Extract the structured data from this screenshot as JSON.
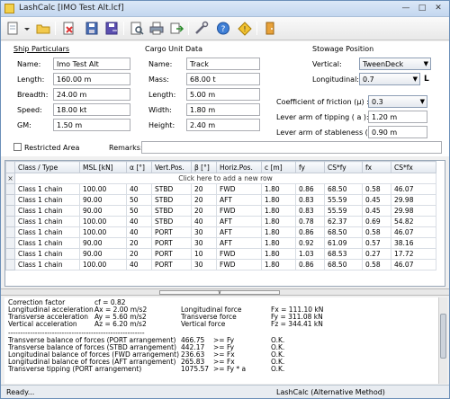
{
  "window": {
    "title": "LashCalc [IMO Test Alt.lcf]"
  },
  "toolbar": {
    "buttons": [
      "new-icon",
      "open-icon",
      "clear-icon",
      "save-icon",
      "save-as-icon",
      "preview-icon",
      "print-icon",
      "export-icon",
      "settings-icon",
      "help-icon",
      "info-icon",
      "exit-icon"
    ]
  },
  "ship": {
    "heading": "Ship Particulars",
    "name_label": "Name:",
    "name": "Imo Test Alt",
    "length_label": "Length:",
    "length": "160.00 m",
    "breadth_label": "Breadth:",
    "breadth": "24.00 m",
    "speed_label": "Speed:",
    "speed": "18.00 kt",
    "gm_label": "GM:",
    "gm": "1.50 m"
  },
  "cargo": {
    "heading": "Cargo Unit Data",
    "name_label": "Name:",
    "name": "Track",
    "mass_label": "Mass:",
    "mass": "68.00 t",
    "length_label": "Length:",
    "length": "5.00 m",
    "width_label": "Width:",
    "width": "1.80 m",
    "height_label": "Height:",
    "height": "2.40 m"
  },
  "stowage": {
    "heading": "Stowage Position",
    "vertical_label": "Vertical:",
    "vertical": "TweenDeck",
    "longitudinal_label": "Longitudinal:",
    "longitudinal": "0.7",
    "longitudinal_unit": "L",
    "friction_label": "Coefficient of friction (μ) :",
    "friction": "0.3",
    "tipping_label": "Lever arm of tipping ( a ):",
    "tipping": "1.20 m",
    "stableness_label": "Lever arm of stableness ( b ):",
    "stableness": "0.90 m"
  },
  "restricted_label": "Restricted Area",
  "remarks_label": "Remarks:",
  "remarks": "",
  "grid": {
    "columns": [
      "Class / Type",
      "MSL [kN]",
      "α [°]",
      "Vert.Pos.",
      "β [°]",
      "Horiz.Pos.",
      "c [m]",
      "fy",
      "CS*fy",
      "fx",
      "CS*fx"
    ],
    "add_row": "Click here to add a new row",
    "rows": [
      [
        "Class 1 chain",
        "100.00",
        "40",
        "STBD",
        "20",
        "FWD",
        "1.80",
        "0.86",
        "68.50",
        "0.58",
        "46.07"
      ],
      [
        "Class 1 chain",
        "90.00",
        "50",
        "STBD",
        "20",
        "AFT",
        "1.80",
        "0.83",
        "55.59",
        "0.45",
        "29.98"
      ],
      [
        "Class 1 chain",
        "90.00",
        "50",
        "STBD",
        "20",
        "FWD",
        "1.80",
        "0.83",
        "55.59",
        "0.45",
        "29.98"
      ],
      [
        "Class 1 chain",
        "100.00",
        "40",
        "STBD",
        "40",
        "AFT",
        "1.80",
        "0.78",
        "62.37",
        "0.69",
        "54.82"
      ],
      [
        "Class 1 chain",
        "100.00",
        "40",
        "PORT",
        "30",
        "AFT",
        "1.80",
        "0.86",
        "68.50",
        "0.58",
        "46.07"
      ],
      [
        "Class 1 chain",
        "90.00",
        "20",
        "PORT",
        "30",
        "AFT",
        "1.80",
        "0.92",
        "61.09",
        "0.57",
        "38.16"
      ],
      [
        "Class 1 chain",
        "90.00",
        "20",
        "PORT",
        "10",
        "FWD",
        "1.80",
        "1.03",
        "68.53",
        "0.27",
        "17.72"
      ],
      [
        "Class 1 chain",
        "100.00",
        "40",
        "PORT",
        "30",
        "FWD",
        "1.80",
        "0.86",
        "68.50",
        "0.58",
        "46.07"
      ]
    ]
  },
  "results": {
    "cf_label": "Correction factor",
    "cf": "cf = 0.82",
    "ax_label": "Longitudinal acceleration",
    "ax": "Ax = 2.00 m/s2",
    "ay_label": "Transverse acceleration",
    "ay": "Ay = 5.60 m/s2",
    "az_label": "Vertical acceleration",
    "az": "Az = 6.20 m/s2",
    "fx_label": "Longitudinal force",
    "fx": "Fx = 111.10 kN",
    "fy_label": "Transverse force",
    "fy": "Fy = 311.08 kN",
    "fz_label": "Vertical force",
    "fz": "Fz = 344.41 kN",
    "divider": "--------------------------------------------------------",
    "balances": [
      [
        "Transverse balance of forces (PORT arrangement)",
        "466.75",
        ">= Fy",
        "O.K."
      ],
      [
        "Transverse balance of forces (STBD arrangement)",
        "442.17",
        ">= Fy",
        "O.K."
      ],
      [
        "Longitudinal balance of forces (FWD arrangement)",
        "236.63",
        ">= Fx",
        "O.K."
      ],
      [
        "Longitudinal balance of forces (AFT arrangement)",
        "265.83",
        ">= Fx",
        "O.K."
      ],
      [
        "Transverse tipping (PORT arrangement)",
        "1075.57",
        ">= Fy * a",
        "O.K."
      ]
    ]
  },
  "status": {
    "left": "Ready...",
    "right": "LashCalc (Alternative Method)"
  }
}
